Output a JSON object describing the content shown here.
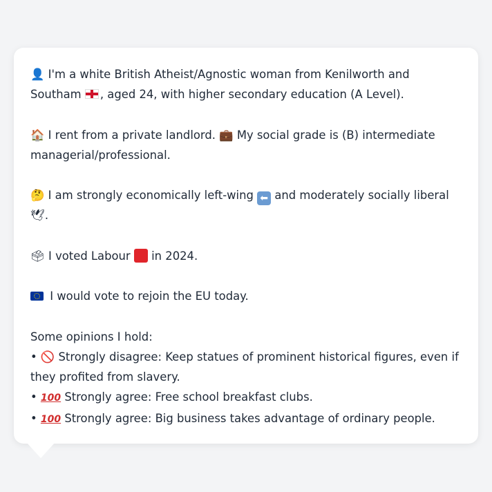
{
  "profile": {
    "identity": {
      "icon": "person-silhouette-icon",
      "text_before_flag": "I'm a white British Atheist/Agnostic woman from Kenilworth and Southam",
      "flag_icon": "england-flag-icon",
      "text_after_flag": ", aged 24, with higher secondary education (A Level)."
    },
    "housing": {
      "icon": "house-icon",
      "text": "I rent from a private landlord.",
      "briefcase_icon": "briefcase-icon",
      "grade_text": "My social grade is (B) intermediate managerial/professional."
    },
    "politics": {
      "icon": "thinking-face-icon",
      "text_before_arrow": "I am strongly economically left-wing",
      "arrow_icon": "left-arrow-icon",
      "text_after_arrow": "and moderately socially liberal",
      "dove_icon": "dove-icon",
      "end": "."
    },
    "vote": {
      "icon": "ballot-box-icon",
      "text_before": "I voted Labour",
      "square_icon": "red-square-icon",
      "text_after": "in 2024."
    },
    "eu": {
      "icon": "eu-flag-icon",
      "text": "I would vote to rejoin the EU today."
    },
    "opinions": {
      "heading": "Some opinions I hold:",
      "items": [
        {
          "bullet": "•",
          "icon": "prohibited-icon",
          "glyph": "🚫",
          "text": "Strongly disagree: Keep statues of prominent historical figures, even if they profited from slavery."
        },
        {
          "bullet": "•",
          "icon": "hundred-points-icon",
          "glyph": "100",
          "text": "Strongly agree: Free school breakfast clubs."
        },
        {
          "bullet": "•",
          "icon": "hundred-points-icon",
          "glyph": "100",
          "text": "Strongly agree: Big business takes advantage of ordinary people."
        }
      ]
    }
  },
  "colors": {
    "background": "#f3f4f6",
    "bubble": "#ffffff",
    "text": "#1f2937"
  }
}
